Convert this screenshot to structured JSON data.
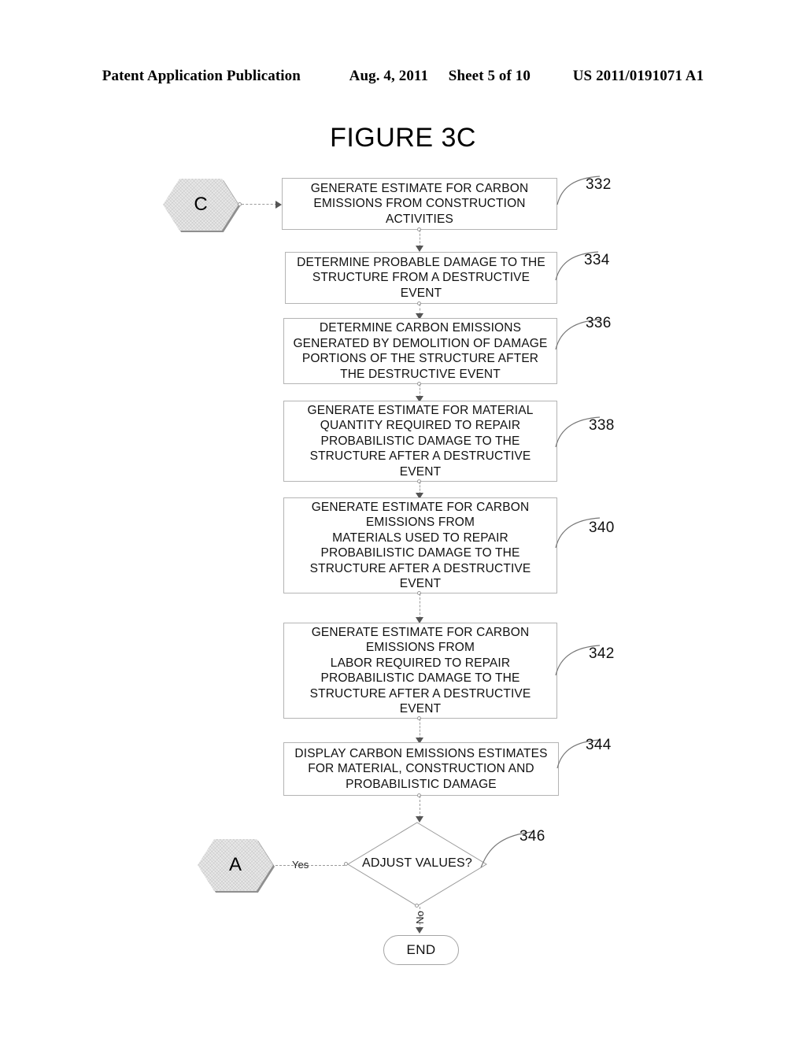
{
  "header": {
    "publication": "Patent Application Publication",
    "date": "Aug. 4, 2011",
    "sheet": "Sheet 5 of 10",
    "docnum": "US 2011/0191071 A1"
  },
  "figure": {
    "title": "FIGURE 3C"
  },
  "connectors": {
    "entry_label": "C",
    "exit_label": "A",
    "yes_label": "Yes",
    "no_label": "No",
    "end_label": "END"
  },
  "steps": [
    {
      "ref": "332",
      "text": "GENERATE ESTIMATE FOR CARBON\nEMISSIONS FROM CONSTRUCTION\nACTIVITIES"
    },
    {
      "ref": "334",
      "text": "DETERMINE PROBABLE DAMAGE TO THE\nSTRUCTURE FROM A DESTRUCTIVE\nEVENT"
    },
    {
      "ref": "336",
      "text": "DETERMINE CARBON EMISSIONS\nGENERATED BY DEMOLITION OF DAMAGE\nPORTIONS OF THE STRUCTURE AFTER\nTHE DESTRUCTIVE EVENT"
    },
    {
      "ref": "338",
      "text": "GENERATE ESTIMATE FOR MATERIAL\nQUANTITY REQUIRED TO REPAIR\nPROBABILISTIC DAMAGE TO THE\nSTRUCTURE AFTER A DESTRUCTIVE\nEVENT"
    },
    {
      "ref": "340",
      "text": "GENERATE ESTIMATE FOR CARBON\nEMISSIONS FROM\nMATERIALS USED TO REPAIR\nPROBABILISTIC DAMAGE TO THE\nSTRUCTURE AFTER A DESTRUCTIVE\nEVENT"
    },
    {
      "ref": "342",
      "text": "GENERATE ESTIMATE FOR CARBON\nEMISSIONS FROM\nLABOR REQUIRED TO REPAIR\nPROBABILISTIC DAMAGE TO THE\nSTRUCTURE AFTER A DESTRUCTIVE\nEVENT"
    },
    {
      "ref": "344",
      "text": "DISPLAY CARBON EMISSIONS ESTIMATES\nFOR MATERIAL, CONSTRUCTION AND\nPROBABILISTIC DAMAGE"
    }
  ],
  "decision": {
    "ref": "346",
    "text": "ADJUST VALUES?"
  },
  "colors": {
    "ink": "#111111",
    "line": "#9a9a9a",
    "node_fill": "#e9e9e9"
  }
}
